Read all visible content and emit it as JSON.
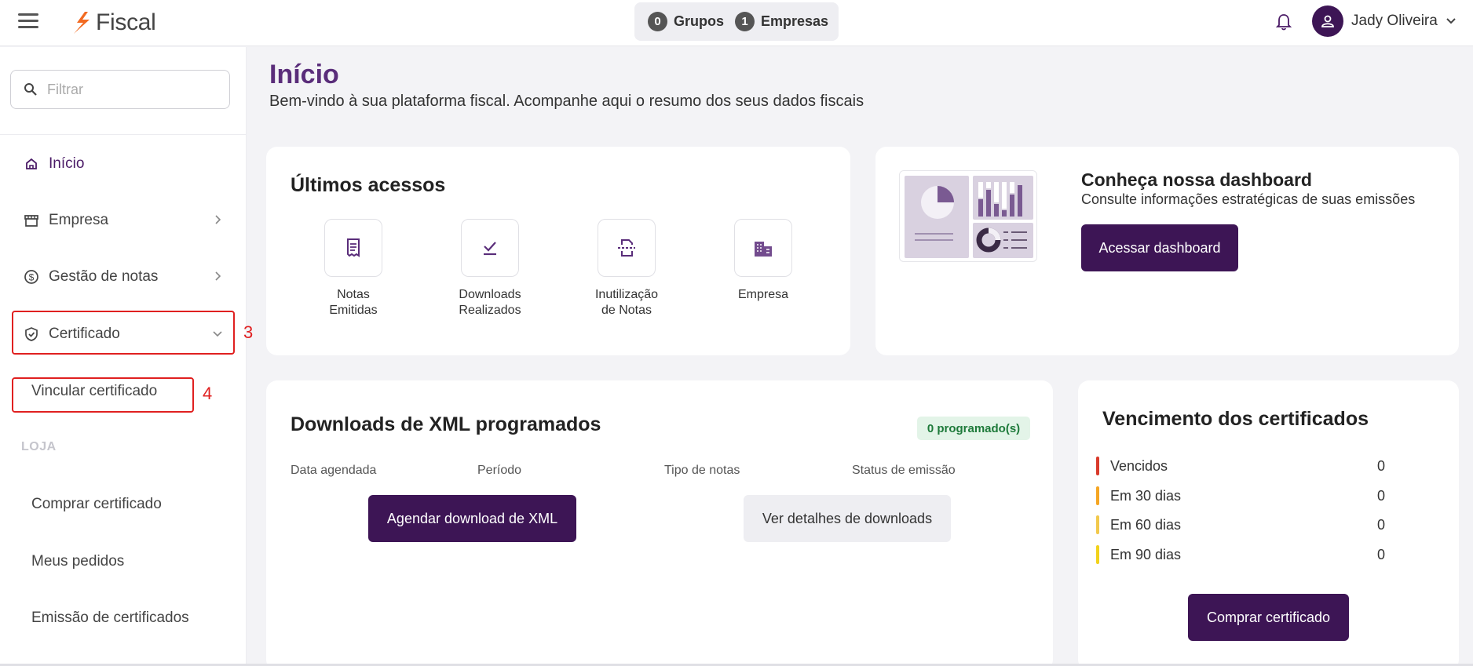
{
  "header": {
    "app_name": "Fiscal",
    "groups_count": "0",
    "groups_label": "Grupos",
    "companies_count": "1",
    "companies_label": "Empresas",
    "user_name": "Jady Oliveira",
    "brand_color": "#3d1555",
    "logo_color": "#f26a21"
  },
  "sidebar": {
    "filter_placeholder": "Filtrar",
    "items": [
      {
        "label": "Início",
        "icon": "home-icon"
      },
      {
        "label": "Empresa",
        "icon": "store-icon"
      },
      {
        "label": "Gestão de notas",
        "icon": "dollar-circle-icon"
      },
      {
        "label": "Certificado",
        "icon": "shield-check-icon"
      }
    ],
    "sub_item": "Vincular certificado",
    "section_label": "LOJA",
    "store_items": [
      "Comprar certificado",
      "Meus pedidos",
      "Emissão de certificados"
    ],
    "annotations": [
      "3",
      "4"
    ]
  },
  "main": {
    "title": "Início",
    "subtitle": "Bem-vindo à sua plataforma fiscal. Acompanhe aqui o resumo dos seus dados fiscais",
    "recent": {
      "title": "Últimos acessos",
      "items": [
        {
          "label": "Notas\nEmitidas",
          "icon": "receipt-icon"
        },
        {
          "label": "Downloads\nRealizados",
          "icon": "check-download-icon"
        },
        {
          "label": "Inutilização\nde Notas",
          "icon": "document-cancel-icon"
        },
        {
          "label": "Empresa",
          "icon": "building-icon"
        }
      ]
    },
    "dashboard": {
      "title": "Conheça nossa dashboard",
      "subtitle": "Consulte informações estratégicas de suas emissões",
      "button": "Acessar dashboard"
    },
    "downloads": {
      "title": "Downloads de XML programados",
      "badge": "0 programado(s)",
      "columns": [
        "Data agendada",
        "Período",
        "Tipo de notas",
        "Status de emissão"
      ],
      "primary_button": "Agendar download de XML",
      "secondary_button": "Ver detalhes de downloads"
    },
    "expiry": {
      "title": "Vencimento dos certificados",
      "rows": [
        {
          "label": "Vencidos",
          "value": "0",
          "color": "#d93a2b"
        },
        {
          "label": "Em 30 dias",
          "value": "0",
          "color": "#f5a623"
        },
        {
          "label": "Em 60 dias",
          "value": "0",
          "color": "#f2c94c"
        },
        {
          "label": "Em 90 dias",
          "value": "0",
          "color": "#f2d21b"
        }
      ],
      "button": "Comprar certificado"
    }
  }
}
